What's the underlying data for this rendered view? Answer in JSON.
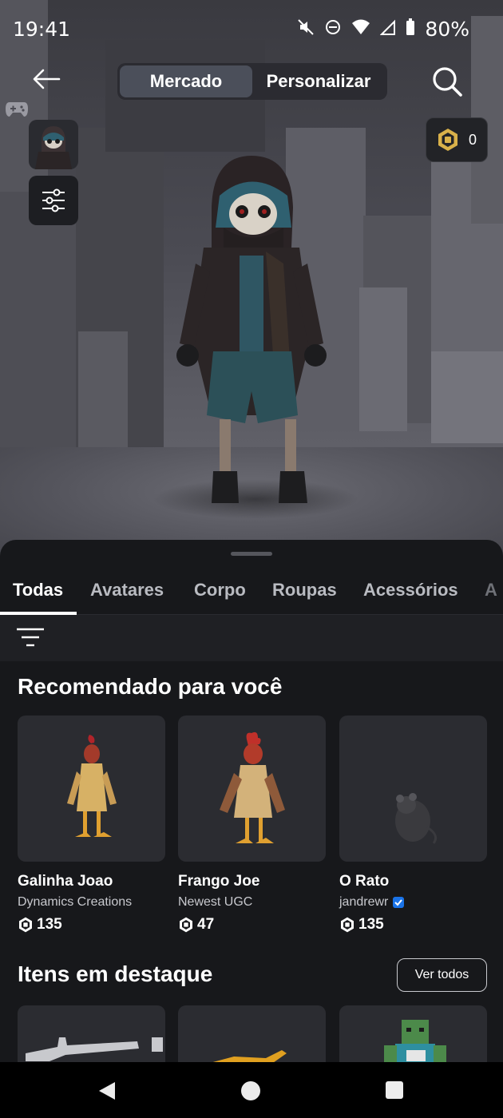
{
  "status_bar": {
    "time": "19:41",
    "battery": "80%"
  },
  "header": {
    "tabs": [
      {
        "label": "Mercado",
        "active": true
      },
      {
        "label": "Personalizar",
        "active": false
      }
    ],
    "robux_balance": "0"
  },
  "categories": [
    {
      "label": "Todas",
      "active": true
    },
    {
      "label": "Avatares",
      "active": false
    },
    {
      "label": "Corpo",
      "active": false
    },
    {
      "label": "Roupas",
      "active": false
    },
    {
      "label": "Acessórios",
      "active": false
    },
    {
      "label": "A",
      "active": false
    }
  ],
  "recommended": {
    "title": "Recomendado para você",
    "items": [
      {
        "name": "Galinha Joao",
        "creator": "Dynamics Creations",
        "price": "135",
        "verified": false
      },
      {
        "name": "Frango Joe",
        "creator": "Newest UGC",
        "price": "47",
        "verified": false
      },
      {
        "name": "O Rato",
        "creator": "jandrewr",
        "price": "135",
        "verified": true
      }
    ]
  },
  "featured": {
    "title": "Itens em destaque",
    "see_all_label": "Ver todos"
  },
  "colors": {
    "sheet_bg": "#17181b",
    "card_bg": "#2b2c31",
    "verified_blue": "#1a73e8",
    "robux_gold": "#d9b14a"
  }
}
